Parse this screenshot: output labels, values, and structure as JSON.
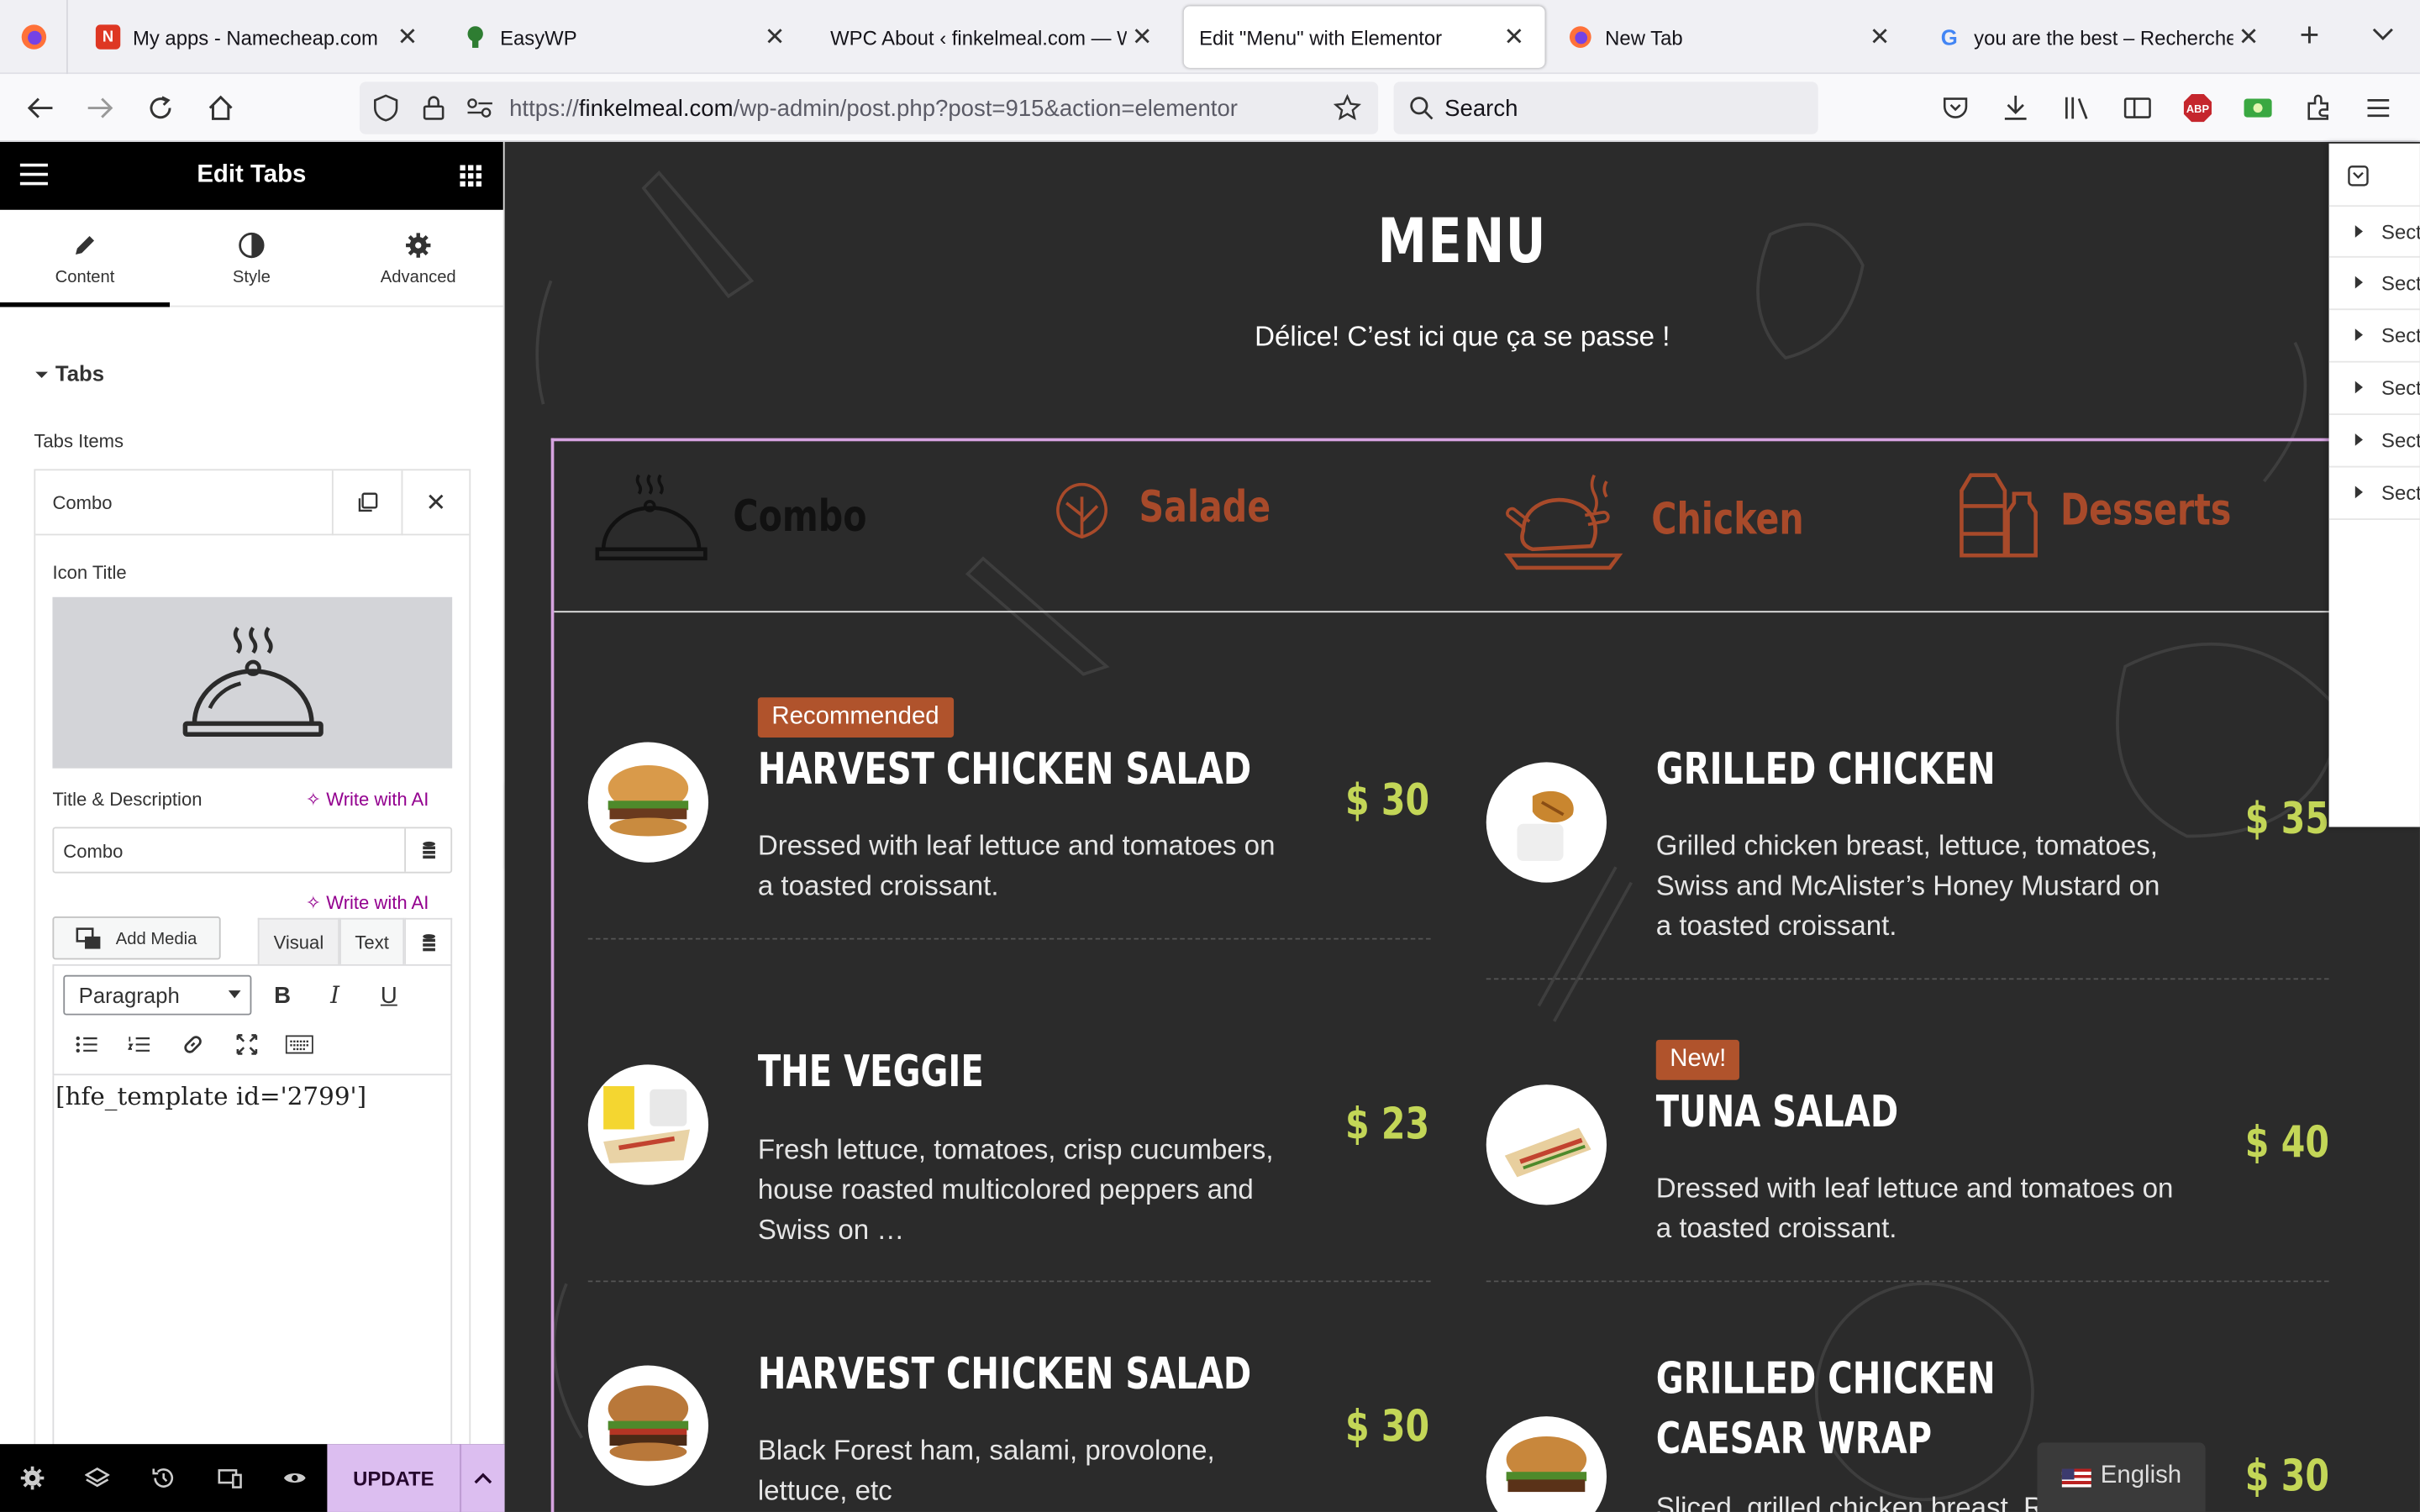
{
  "browser": {
    "tabs": [
      {
        "title": "My apps - Namecheap.com"
      },
      {
        "title": "EasyWP"
      },
      {
        "title": "WPC About ‹ finkelmeal.com — WordPress"
      },
      {
        "title": "Edit \"Menu\" with Elementor"
      },
      {
        "title": "New Tab"
      },
      {
        "title": "you are the best – Recherche Google"
      }
    ],
    "url_prefix": "https://",
    "url_domain": "finkelmeal.com",
    "url_path": "/wp-admin/post.php?post=915&action=elementor",
    "search_placeholder": "Search"
  },
  "panel": {
    "title": "Edit Tabs",
    "tabs": [
      {
        "label": "Content"
      },
      {
        "label": "Style"
      },
      {
        "label": "Advanced"
      }
    ],
    "section": "Tabs",
    "items_label": "Tabs Items",
    "item_title": "Combo",
    "icon_title_label": "Icon Title",
    "title_desc_label": "Title & Description",
    "write_ai": "Write with AI",
    "title_value": "Combo",
    "add_media": "Add Media",
    "visual": "Visual",
    "text": "Text",
    "format": "Paragraph",
    "editor_content": "[hfe_template id='2799']",
    "update": "UPDATE"
  },
  "preview": {
    "heading": "MENU",
    "subheading": "Délice! C’est ici que ça se passe !",
    "tabs": [
      {
        "name": "Combo",
        "color": "#111111"
      },
      {
        "name": "Salade",
        "color": "#a84a2a"
      },
      {
        "name": "Chicken",
        "color": "#a84a2a"
      },
      {
        "name": "Desserts",
        "color": "#a84a2a"
      }
    ],
    "items": [
      {
        "badge": "Recommended",
        "title": "HARVEST CHICKEN SALAD",
        "desc": "Dressed with leaf lettuce and tomatoes on a toasted croissant.",
        "price": "$ 30"
      },
      {
        "badge": "",
        "title": "GRILLED CHICKEN",
        "desc": "Grilled chicken breast, lettuce, tomatoes, Swiss and McAlister’s Honey Mustard on a toasted croissant.",
        "price": "$ 35"
      },
      {
        "badge": "",
        "title": "THE VEGGIE",
        "desc": "Fresh lettuce, tomatoes, crisp cucumbers, house roasted multicolored peppers and Swiss on …",
        "price": "$ 23"
      },
      {
        "badge": "New!",
        "title": "TUNA SALAD",
        "desc": "Dressed with leaf lettuce and tomatoes on a toasted croissant.",
        "price": "$ 40"
      },
      {
        "badge": "",
        "title": "HARVEST CHICKEN SALAD",
        "desc": "Black Forest ham, salami, provolone, lettuce, etc",
        "price": "$ 30"
      },
      {
        "badge": "",
        "title": "GRILLED CHICKEN CAESAR WRAP",
        "desc": "Sliced, grilled chicken breast, R",
        "price": "$ 30"
      }
    ],
    "navigator_rows": [
      "Sect",
      "Sect",
      "Sect",
      "Sect",
      "Sect",
      "Sect"
    ],
    "language": "English"
  }
}
